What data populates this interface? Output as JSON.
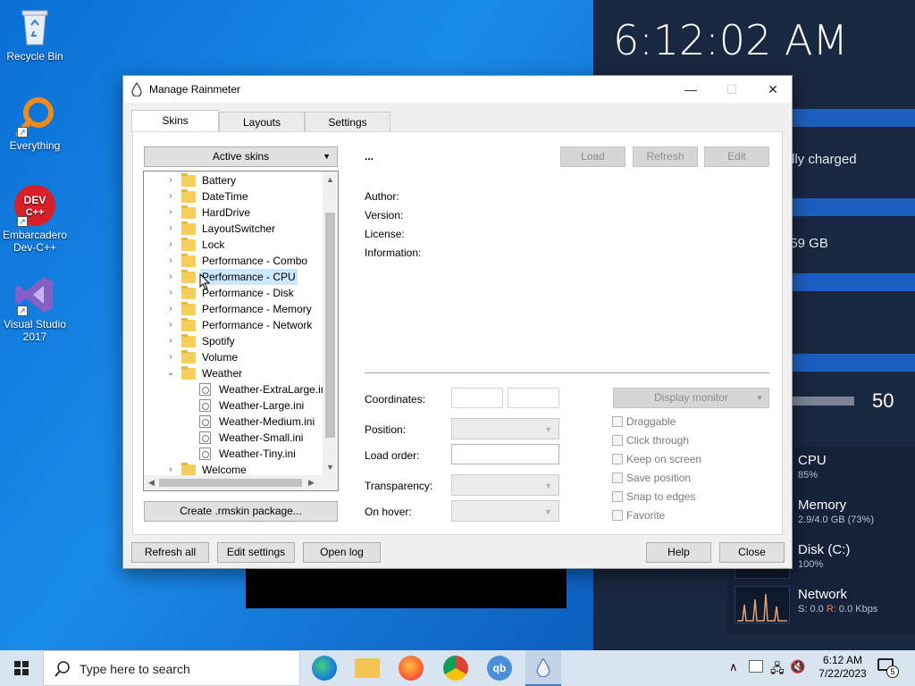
{
  "desktop": {
    "icons": [
      {
        "label": "Recycle Bin"
      },
      {
        "label": "Everything"
      },
      {
        "label": "Embarcadero Dev-C++"
      },
      {
        "label": "Visual Studio 2017"
      }
    ],
    "devcpp_logo": "DEV C++"
  },
  "rainmeter_skins": {
    "clock": "6:12:02 AM",
    "battery_text": "lly charged",
    "disk_text": "/ 59 GB",
    "volume": "50",
    "cpu": {
      "label": "CPU",
      "value": "85%"
    },
    "memory": {
      "label": "Memory",
      "value": "2.9/4.0 GB (73%)"
    },
    "disk": {
      "label": "Disk (C:)",
      "value": "100%"
    },
    "network": {
      "label": "Network",
      "send_label": "S:",
      "send": "0.0",
      "recv_label": "R:",
      "recv": "0.0 Kbps"
    }
  },
  "window": {
    "title": "Manage Rainmeter",
    "controls": {
      "minimize": "—",
      "maximize": "☐",
      "close": "✕"
    },
    "tabs": [
      {
        "label": "Skins",
        "active": true
      },
      {
        "label": "Layouts",
        "active": false
      },
      {
        "label": "Settings",
        "active": false
      }
    ],
    "skins_dropdown": "Active skins",
    "tree": [
      {
        "label": "Battery",
        "type": "folder",
        "expanded": false
      },
      {
        "label": "DateTime",
        "type": "folder",
        "expanded": false
      },
      {
        "label": "HardDrive",
        "type": "folder",
        "expanded": false
      },
      {
        "label": "LayoutSwitcher",
        "type": "folder",
        "expanded": false
      },
      {
        "label": "Lock",
        "type": "folder",
        "expanded": false
      },
      {
        "label": "Performance - Combo",
        "type": "folder",
        "expanded": false
      },
      {
        "label": "Performance - CPU",
        "type": "folder",
        "expanded": false,
        "selected": true
      },
      {
        "label": "Performance - Disk",
        "type": "folder",
        "expanded": false
      },
      {
        "label": "Performance - Memory",
        "type": "folder",
        "expanded": false
      },
      {
        "label": "Performance - Network",
        "type": "folder",
        "expanded": false
      },
      {
        "label": "Spotify",
        "type": "folder",
        "expanded": false
      },
      {
        "label": "Volume",
        "type": "folder",
        "expanded": false
      },
      {
        "label": "Weather",
        "type": "folder",
        "expanded": true
      },
      {
        "label": "Weather-ExtraLarge.ini",
        "type": "file"
      },
      {
        "label": "Weather-Large.ini",
        "type": "file"
      },
      {
        "label": "Weather-Medium.ini",
        "type": "file"
      },
      {
        "label": "Weather-Small.ini",
        "type": "file"
      },
      {
        "label": "Weather-Tiny.ini",
        "type": "file"
      },
      {
        "label": "Welcome",
        "type": "folder",
        "expanded": false
      }
    ],
    "create_package": "Create .rmskin package...",
    "skin_name": "...",
    "buttons": {
      "load": "Load",
      "refresh": "Refresh",
      "edit": "Edit"
    },
    "metadata": {
      "author": "Author:",
      "version": "Version:",
      "license": "License:",
      "information": "Information:"
    },
    "settings": {
      "coordinates": "Coordinates:",
      "position": "Position:",
      "load_order": "Load order:",
      "transparency": "Transparency:",
      "on_hover": "On hover:",
      "display_monitor": "Display monitor"
    },
    "checkboxes": [
      "Draggable",
      "Click through",
      "Keep on screen",
      "Save position",
      "Snap to edges",
      "Favorite"
    ],
    "footer": {
      "refresh_all": "Refresh all",
      "edit_settings": "Edit settings",
      "open_log": "Open log",
      "help": "Help",
      "close": "Close"
    }
  },
  "taskbar": {
    "search_placeholder": "Type here to search",
    "time": "6:12 AM",
    "date": "7/22/2023",
    "notification_count": "5"
  }
}
